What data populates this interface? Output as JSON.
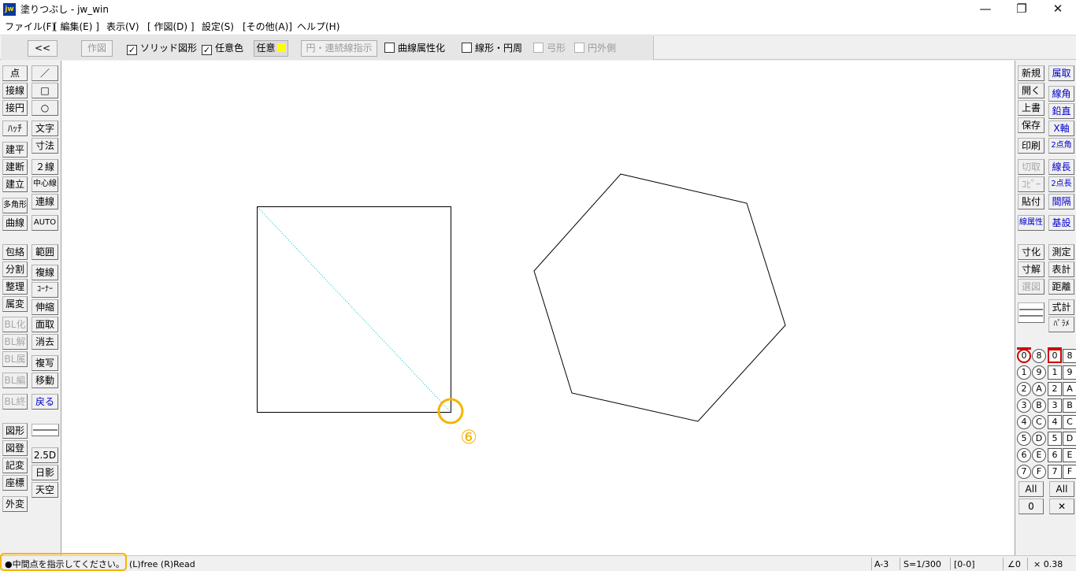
{
  "window": {
    "icon_text": "jw",
    "title": "塗りつぶし - jw_win",
    "minimize_glyph": "—",
    "restore_glyph": "❐",
    "close_glyph": "✕"
  },
  "menu": [
    "ファイル(F)",
    "[ 編集(E) ]",
    "表示(V)",
    "[ 作図(D) ]",
    "設定(S)",
    "[その他(A)]",
    "ヘルプ(H)"
  ],
  "toolbar": {
    "collapse_label": "<<",
    "draw_label": "作図",
    "solid_shape_label": "ソリッド図形",
    "solid_shape_checked": true,
    "custom_color_label": "任意色",
    "custom_color_checked": true,
    "custom_label": "任意",
    "custom_swatch_color": "#ffff00",
    "circle_continuous_label": "円・連続線指示",
    "curve_attr_label": "曲線属性化",
    "curve_attr_checked": false,
    "linear_circle_label": "線形・円周",
    "linear_circle_checked": false,
    "arc_label": "弓形",
    "arc_checked": false,
    "outer_circle_label": "円外側",
    "outer_circle_checked": false,
    "check_mark": "✓"
  },
  "left_tools": {
    "col1": [
      "点",
      "接線",
      "接円",
      "ﾊｯﾁ",
      "建平",
      "建断",
      "建立",
      "多角形",
      "曲線",
      "包絡",
      "分割",
      "整理",
      "属変",
      "BL化",
      "BL解",
      "BL属",
      "BL編",
      "BL終",
      "図形",
      "図登",
      "記変",
      "座標",
      "外変"
    ],
    "col2": [
      "／",
      "□",
      "○",
      "文字",
      "寸法",
      "２線",
      "中心線",
      "連線",
      "AUTO",
      "範囲",
      "複線",
      "ｺｰﾅｰ",
      "伸縮",
      "面取",
      "消去",
      "複写",
      "移動",
      "戻る",
      "2.5D",
      "日影",
      "天空"
    ]
  },
  "right_tools": {
    "col1": [
      "新規",
      "開く",
      "上書",
      "保存",
      "印刷",
      "切取",
      "ｺﾋﾟｰ",
      "貼付",
      "線属性",
      "寸化",
      "寸解",
      "選図"
    ],
    "col2": [
      "属取",
      "線角",
      "鉛直",
      "X軸",
      "2点角",
      "線長",
      "2点長",
      "間隔",
      "基設",
      "測定",
      "表計",
      "距離",
      "式計",
      "ﾊﾟﾗﾒ"
    ]
  },
  "layers": {
    "group_labels_left": [
      "0",
      "1",
      "2",
      "3",
      "4",
      "5",
      "6",
      "7"
    ],
    "group_labels_right": [
      "8",
      "9",
      "A",
      "B",
      "C",
      "D",
      "E",
      "F"
    ],
    "all_label": "All",
    "zero_label": "0",
    "cross_label": "✕"
  },
  "canvas": {
    "step_number": "⑥",
    "highlight_color": "#f5b400"
  },
  "status": {
    "message": "●中間点を指示してください。",
    "mouse_hint": "(L)free (R)Read",
    "paper": "A-3",
    "scale": "S=1/300",
    "layer": "[0-0]",
    "angle": "∠0",
    "zoom": "× 0.38"
  }
}
